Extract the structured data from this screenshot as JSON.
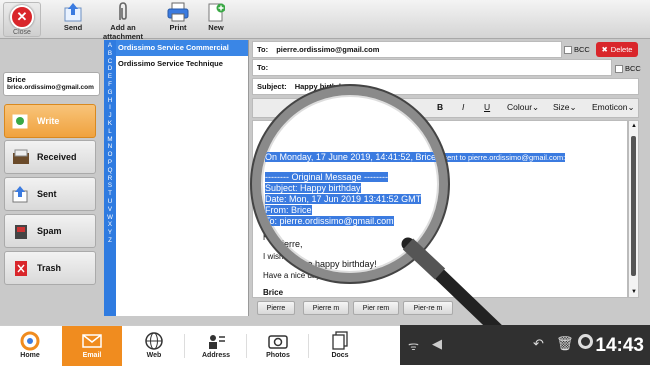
{
  "toolbar": {
    "close_label": "Close",
    "send_label": "Send",
    "attach_label": "Add an attachment",
    "print_label": "Print",
    "new_label": "New"
  },
  "user": {
    "name": "Brice",
    "email": "brice.ordissimo@gmail.com"
  },
  "folders": [
    {
      "label": "Write",
      "icon": "write-icon"
    },
    {
      "label": "Received",
      "icon": "inbox-icon"
    },
    {
      "label": "Sent",
      "icon": "sent-icon"
    },
    {
      "label": "Spam",
      "icon": "spam-icon"
    },
    {
      "label": "Trash",
      "icon": "trash-icon"
    }
  ],
  "alphabet": [
    "A",
    "B",
    "C",
    "D",
    "E",
    "F",
    "G",
    "H",
    "I",
    "J",
    "K",
    "L",
    "M",
    "N",
    "O",
    "P",
    "Q",
    "R",
    "S",
    "T",
    "U",
    "V",
    "W",
    "X",
    "Y",
    "Z"
  ],
  "contacts": [
    "Ordissimo Service Commercial",
    "Ordissimo Service Technique"
  ],
  "compose": {
    "to_label": "To:",
    "to_value": "pierre.ordissimo@gmail.com",
    "to2_label": "To:",
    "bcc_label": "BCC",
    "subject_label": "Subject:",
    "subject_value": "Happy birthday",
    "delete_label": "Delete"
  },
  "format": {
    "bold": "B",
    "italic": "I",
    "underline": "U",
    "colour": "Colour",
    "size": "Size",
    "emoticon": "Emoticon"
  },
  "body": {
    "intro_line": "On Monday, 17 June 2019, 14:41:52, Brice wrote was sent to pierre.ordissimo@gmail.com:",
    "orig_header": "-------- Original Message --------",
    "orig_subject": "Subject: Happy birthday",
    "orig_date": "Date: Mon, 17 Jun 2019 13:41:52 GMT",
    "orig_from_label": "From:",
    "orig_from_value": "Brice",
    "orig_to": "To: pierre.ordissimo@gmail.com",
    "greeting": "Hi Pierre,",
    "wish": "I wish you a happy birthday!",
    "closing": "Have a nice day",
    "signature": "Brice"
  },
  "quick_replies": [
    "Pierre",
    "Pierre m",
    "Pier rem",
    "Pier-re m"
  ],
  "taskbar": [
    {
      "label": "Home",
      "icon": "home-icon"
    },
    {
      "label": "Email",
      "icon": "email-icon"
    },
    {
      "label": "Web",
      "icon": "web-icon"
    },
    {
      "label": "Address",
      "icon": "address-icon"
    },
    {
      "label": "Photos",
      "icon": "photos-icon"
    },
    {
      "label": "Docs",
      "icon": "docs-icon"
    }
  ],
  "clock": "14:43",
  "colors": {
    "accent": "#f08c1f",
    "selection": "#3b7be0",
    "delete": "#d9262b"
  }
}
